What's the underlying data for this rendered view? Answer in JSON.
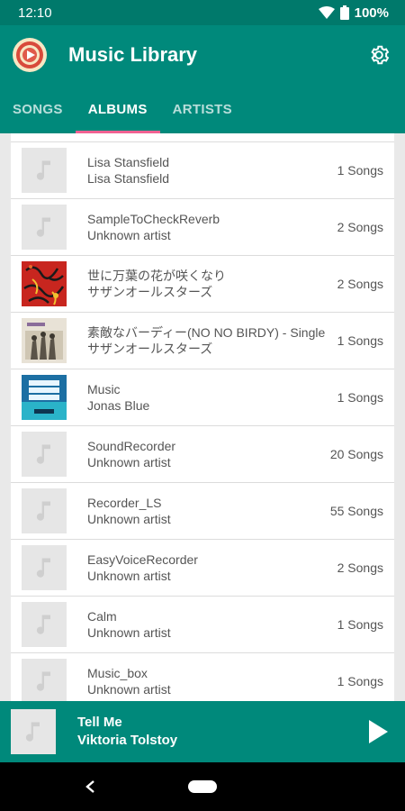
{
  "status": {
    "time": "12:10",
    "battery": "100%"
  },
  "app": {
    "title": "Music Library"
  },
  "tabs": [
    {
      "label": "SONGS",
      "active": false
    },
    {
      "label": "ALBUMS",
      "active": true
    },
    {
      "label": "ARTISTS",
      "active": false
    }
  ],
  "albums": [
    {
      "title": "Lisa Stansfield",
      "artist": "Lisa Stansfield",
      "count": "1 Songs",
      "art": "placeholder"
    },
    {
      "title": "SampleToCheckReverb",
      "artist": "Unknown artist",
      "count": "2 Songs",
      "art": "placeholder"
    },
    {
      "title": "世に万葉の花が咲くなり",
      "artist": "サザンオールスターズ",
      "count": "2 Songs",
      "art": "red-cover"
    },
    {
      "title": "素敵なバーディー(NO NO BIRDY) - Single",
      "artist": "サザンオールスターズ",
      "count": "1 Songs",
      "art": "photo-cover"
    },
    {
      "title": "Music",
      "artist": "Jonas Blue",
      "count": "1 Songs",
      "art": "blue-cover"
    },
    {
      "title": "SoundRecorder",
      "artist": "Unknown artist",
      "count": "20 Songs",
      "art": "placeholder"
    },
    {
      "title": "Recorder_LS",
      "artist": "Unknown artist",
      "count": "55 Songs",
      "art": "placeholder"
    },
    {
      "title": "EasyVoiceRecorder",
      "artist": "Unknown artist",
      "count": "2 Songs",
      "art": "placeholder"
    },
    {
      "title": "Calm",
      "artist": "Unknown artist",
      "count": "1 Songs",
      "art": "placeholder"
    },
    {
      "title": "Music_box",
      "artist": "Unknown artist",
      "count": "1 Songs",
      "art": "placeholder"
    }
  ],
  "now_playing": {
    "title": "Tell Me",
    "artist": "Viktoria Tolstoy"
  },
  "colors": {
    "primary": "#00897b",
    "status": "#00796b",
    "indicator": "#f06292"
  }
}
